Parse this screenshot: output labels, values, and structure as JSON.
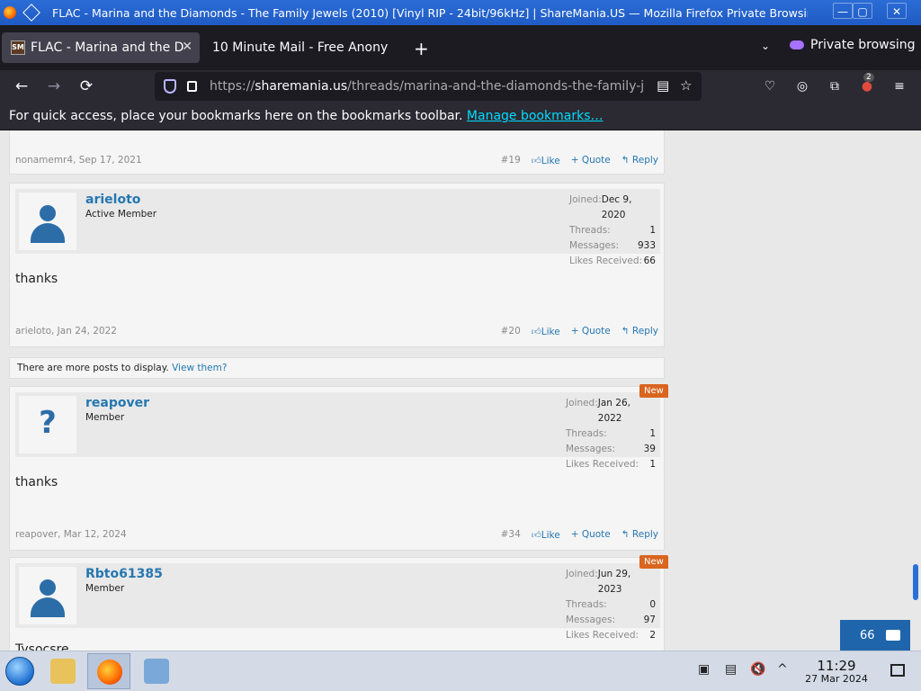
{
  "window": {
    "title": "FLAC - Marina and the Diamonds - The Family Jewels (2010) [Vinyl RIP - 24bit/96kHz] | ShareMania.US — Mozilla Firefox Private Browsing",
    "minimize": "—",
    "maximize": "▢",
    "close": "✕"
  },
  "tabs": [
    {
      "label": "FLAC - Marina and the Di",
      "favicon": "SM",
      "close": "✕"
    },
    {
      "label": "10 Minute Mail - Free Anony",
      "close": ""
    }
  ],
  "tabstrip": {
    "new_tab": "+",
    "list_all": "⌄",
    "private_label": "Private browsing"
  },
  "navbar": {
    "back": "←",
    "forward": "→",
    "reload": "⟳",
    "url_prefix": "https://",
    "url_host": "sharemania.us",
    "url_path": "/threads/marina-and-the-diamonds-the-family-j",
    "reader": "▤",
    "bookmark": "☆",
    "pocket": "♡",
    "account": "◎",
    "extensions": "⧉",
    "ext_badge": "2",
    "menu": "≡"
  },
  "bookmarks": {
    "message": "For quick access, place your bookmarks here on the bookmarks toolbar.",
    "link": "Manage bookmarks…"
  },
  "posts": [
    {
      "id": "p19",
      "footer": "nonamemr4, Sep 17, 2021",
      "number": "#19",
      "like": "Like",
      "quote": "+ Quote",
      "reply": "Reply"
    },
    {
      "id": "p20",
      "username": "arieloto",
      "role": "Active Member",
      "joined_label": "Joined:",
      "joined": "Dec 9, 2020",
      "threads_label": "Threads:",
      "threads": "1",
      "messages_label": "Messages:",
      "messages": "933",
      "likes_label": "Likes Received:",
      "likes": "66",
      "text": "thanks",
      "footer": "arieloto, Jan 24, 2022",
      "number": "#20",
      "like": "Like",
      "quote": "+ Quote",
      "reply": "Reply"
    },
    {
      "id": "p34",
      "badge": "New",
      "username": "reapover",
      "role": "Member",
      "joined_label": "Joined:",
      "joined": "Jan 26, 2022",
      "threads_label": "Threads:",
      "threads": "1",
      "messages_label": "Messages:",
      "messages": "39",
      "likes_label": "Likes Received:",
      "likes": "1",
      "text": "thanks",
      "footer": "reapover, Mar 12, 2024",
      "number": "#34",
      "like": "Like",
      "quote": "+ Quote",
      "reply": "Reply"
    },
    {
      "id": "p35",
      "badge": "New",
      "username": "Rbto61385",
      "role": "Member",
      "joined_label": "Joined:",
      "joined": "Jun 29, 2023",
      "threads_label": "Threads:",
      "threads": "0",
      "messages_label": "Messages:",
      "messages": "97",
      "likes_label": "Likes Received:",
      "likes": "2",
      "text": "Tysocsre"
    }
  ],
  "more_posts": {
    "text": "There are more posts to display.",
    "link": "View them?"
  },
  "chat": {
    "count": "66"
  },
  "taskbar": {
    "clock_time": "11:29",
    "clock_date": "27 Mar 2024",
    "tray_clipboard": "▣",
    "tray_volume": "🔇",
    "tray_arrow": "^"
  },
  "colors": {
    "accent": "#2577b1",
    "new_badge": "#d9651f",
    "titlebar": "#2b6cd6"
  }
}
